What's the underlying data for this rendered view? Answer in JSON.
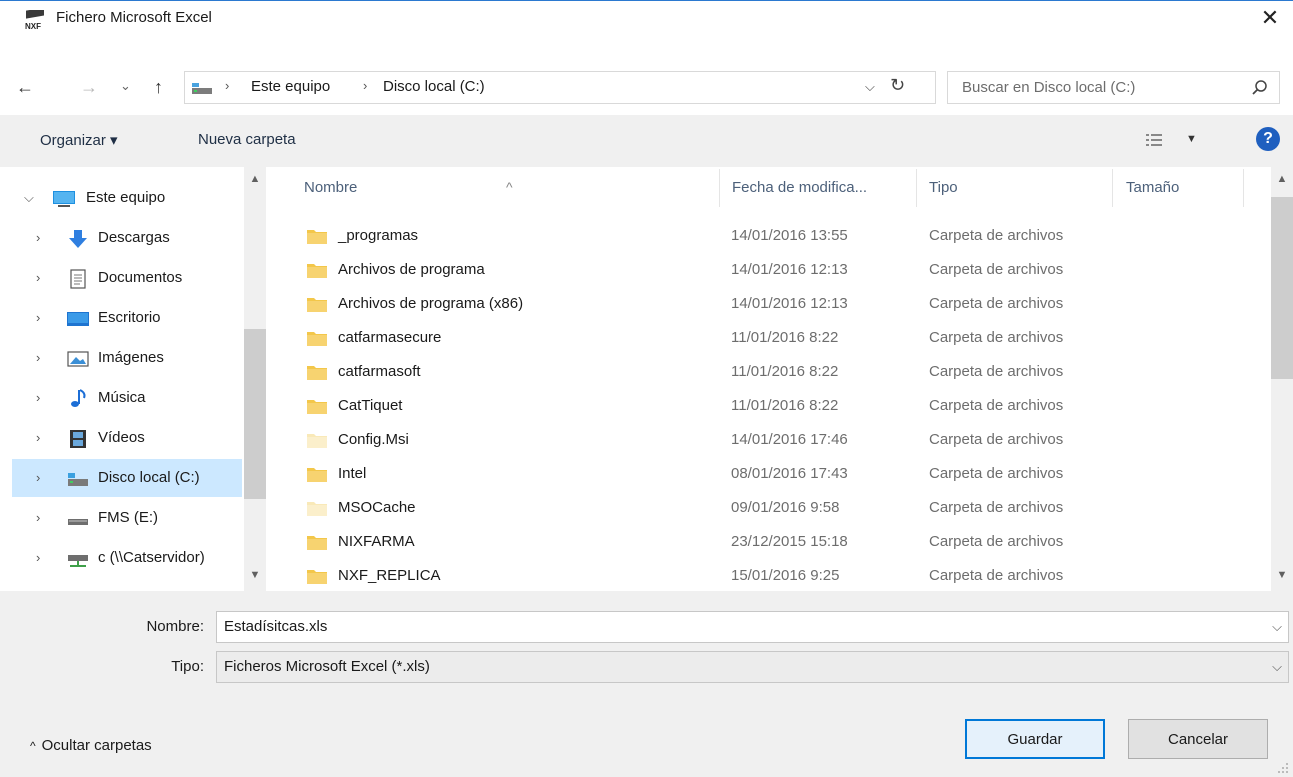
{
  "window": {
    "title": "Fichero Microsoft Excel",
    "app_icon_text": "NXF"
  },
  "nav": {
    "back": "←",
    "forward": "→",
    "recent": "⌄",
    "up": "↑",
    "breadcrumbs": [
      "Este equipo",
      "Disco local (C:)"
    ],
    "search_placeholder": "Buscar en Disco local (C:)"
  },
  "toolbar": {
    "organize_label": "Organizar ▾",
    "new_folder_label": "Nueva carpeta",
    "help_label": "?"
  },
  "sidebar": {
    "items": [
      {
        "label": "Este equipo",
        "icon": "computer-icon",
        "expanded": true
      },
      {
        "label": "Descargas",
        "icon": "downloads-icon"
      },
      {
        "label": "Documentos",
        "icon": "documents-icon"
      },
      {
        "label": "Escritorio",
        "icon": "desktop-icon"
      },
      {
        "label": "Imágenes",
        "icon": "pictures-icon"
      },
      {
        "label": "Música",
        "icon": "music-icon"
      },
      {
        "label": "Vídeos",
        "icon": "videos-icon"
      },
      {
        "label": "Disco local (C:)",
        "icon": "local-disk-icon",
        "selected": true
      },
      {
        "label": "FMS (E:)",
        "icon": "drive-icon"
      },
      {
        "label": "c (\\\\Catservidor)",
        "icon": "network-drive-icon"
      }
    ]
  },
  "filelist": {
    "columns": {
      "name": "Nombre",
      "date": "Fecha de modifica...",
      "type": "Tipo",
      "size": "Tamaño"
    },
    "rows": [
      {
        "name": "_programas",
        "date": "14/01/2016 13:55",
        "type": "Carpeta de archivos",
        "hidden": false
      },
      {
        "name": "Archivos de programa",
        "date": "14/01/2016 12:13",
        "type": "Carpeta de archivos",
        "hidden": false
      },
      {
        "name": "Archivos de programa (x86)",
        "date": "14/01/2016 12:13",
        "type": "Carpeta de archivos",
        "hidden": false
      },
      {
        "name": "catfarmasecure",
        "date": "11/01/2016 8:22",
        "type": "Carpeta de archivos",
        "hidden": false
      },
      {
        "name": "catfarmasoft",
        "date": "11/01/2016 8:22",
        "type": "Carpeta de archivos",
        "hidden": false
      },
      {
        "name": "CatTiquet",
        "date": "11/01/2016 8:22",
        "type": "Carpeta de archivos",
        "hidden": false
      },
      {
        "name": "Config.Msi",
        "date": "14/01/2016 17:46",
        "type": "Carpeta de archivos",
        "hidden": true
      },
      {
        "name": "Intel",
        "date": "08/01/2016 17:43",
        "type": "Carpeta de archivos",
        "hidden": false
      },
      {
        "name": "MSOCache",
        "date": "09/01/2016 9:58",
        "type": "Carpeta de archivos",
        "hidden": true
      },
      {
        "name": "NIXFARMA",
        "date": "23/12/2015 15:18",
        "type": "Carpeta de archivos",
        "hidden": false
      },
      {
        "name": "NXF_REPLICA",
        "date": "15/01/2016 9:25",
        "type": "Carpeta de archivos",
        "hidden": false
      }
    ]
  },
  "form": {
    "filename_label": "Nombre:",
    "filename_value": "Estadísitcas.xls",
    "filetype_label": "Tipo:",
    "filetype_value": "Ficheros Microsoft Excel (*.xls)",
    "hide_folders_label": "Ocultar carpetas",
    "save_label": "Guardar",
    "cancel_label": "Cancelar"
  },
  "colors": {
    "accent": "#0078d7",
    "selection": "#cce8ff",
    "folder": "#f3c74a",
    "folder_hidden": "#f9e9b8"
  }
}
